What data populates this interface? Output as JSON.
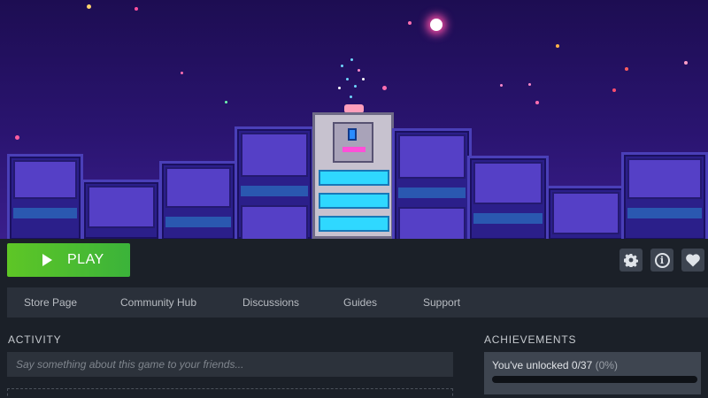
{
  "hero": {
    "sky_top": "#1d0d52",
    "sky_bottom": "#3a1e8c"
  },
  "toolbar": {
    "play_label": "PLAY",
    "play_color": "#5ec626",
    "icons": [
      "gear-icon",
      "info-icon",
      "heart-icon"
    ]
  },
  "nav": {
    "items": [
      {
        "label": "Store Page"
      },
      {
        "label": "Community Hub"
      },
      {
        "label": "Discussions"
      },
      {
        "label": "Guides"
      },
      {
        "label": "Support"
      }
    ]
  },
  "activity": {
    "title": "ACTIVITY",
    "placeholder": "Say something about this game to your friends..."
  },
  "achievements": {
    "title": "ACHIEVEMENTS",
    "unlocked_text": "You've unlocked 0/37",
    "percent_text": "(0%)",
    "unlocked": 0,
    "total": 37,
    "progress_fraction": 0.0
  }
}
